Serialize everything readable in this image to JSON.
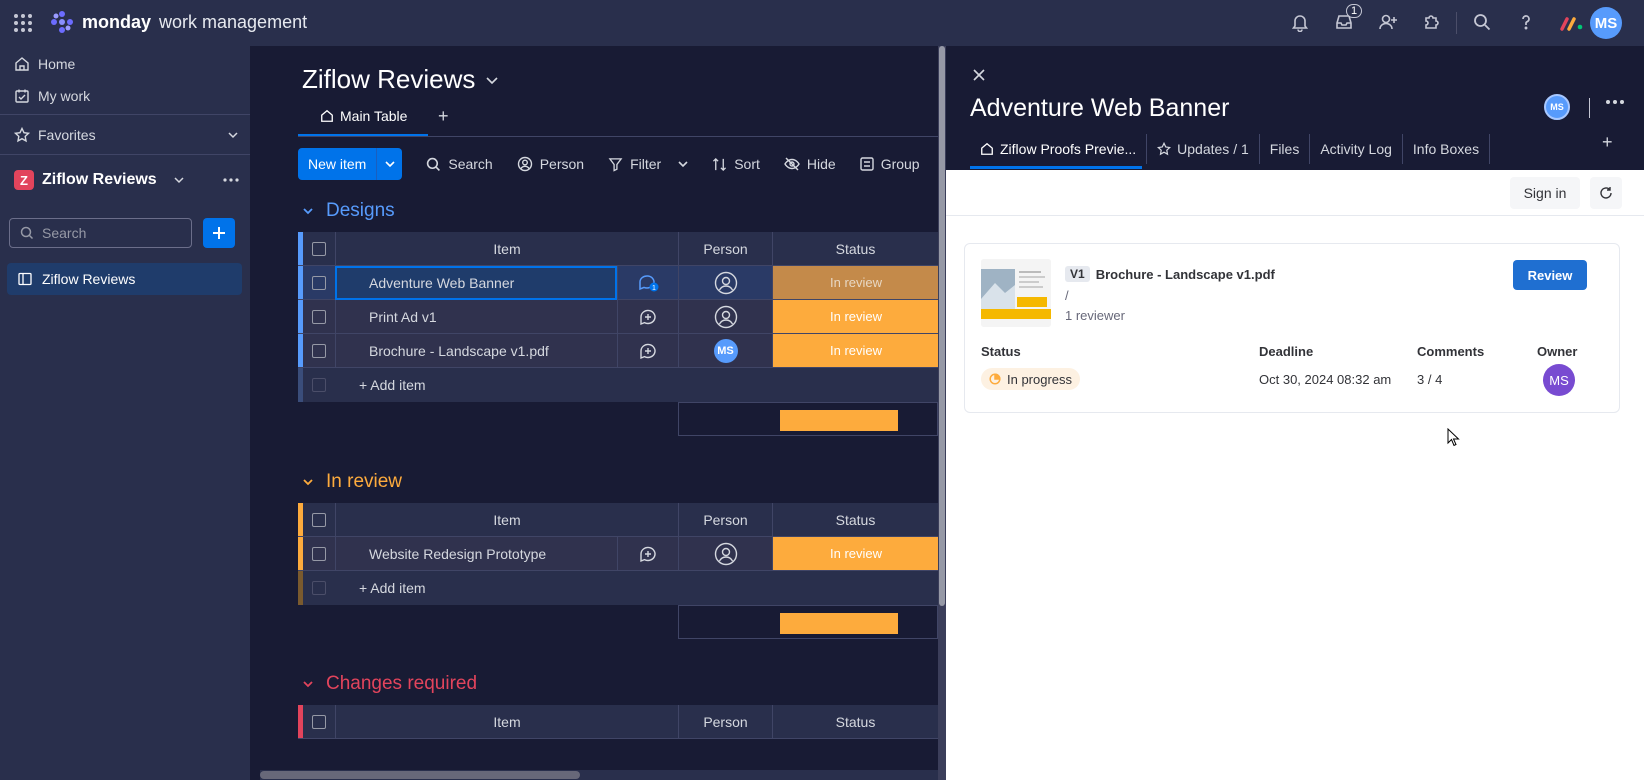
{
  "app": {
    "brand_bold": "monday",
    "brand_light": "work management",
    "inbox_count": "1",
    "user_initials": "MS"
  },
  "sidebar": {
    "home": "Home",
    "my_work": "My work",
    "favorites": "Favorites",
    "workspace_letter": "Z",
    "workspace_name": "Ziflow Reviews",
    "search_placeholder": "Search",
    "boards": [
      {
        "label": "Ziflow Reviews"
      }
    ]
  },
  "board": {
    "title": "Ziflow Reviews",
    "tab_main": "Main Table",
    "tab_add": "+",
    "toolbar": {
      "new_item": "New item",
      "search": "Search",
      "person": "Person",
      "filter": "Filter",
      "sort": "Sort",
      "hide": "Hide",
      "group": "Group"
    },
    "columns": {
      "item": "Item",
      "person": "Person",
      "status": "Status"
    },
    "add_item": "+ Add item",
    "groups": [
      {
        "title": "Designs",
        "color": "#579bfc",
        "rows": [
          {
            "item": "Adventure Web Banner",
            "status": "In review",
            "update_count": "1"
          },
          {
            "item": "Print Ad v1",
            "status": "In review"
          },
          {
            "item": "Brochure - Landscape v1.pdf",
            "status": "In review",
            "person": "MS"
          }
        ]
      },
      {
        "title": "In review",
        "color": "#fdab3d",
        "rows": [
          {
            "item": "Website Redesign Prototype",
            "status": "In review"
          }
        ]
      },
      {
        "title": "Changes required",
        "color": "#e2445c",
        "rows": []
      }
    ]
  },
  "panel": {
    "title": "Adventure Web Banner",
    "avatar": "MS",
    "tabs": [
      "Ziflow Proofs Previe...",
      "Updates / 1",
      "Files",
      "Activity Log",
      "Info Boxes"
    ],
    "add_tab": "+",
    "sign_in": "Sign in",
    "proof": {
      "version": "V1",
      "name": "Brochure - Landscape v1.pdf",
      "path": "/",
      "reviewers": "1 reviewer",
      "review_button": "Review",
      "labels": {
        "status": "Status",
        "deadline": "Deadline",
        "comments": "Comments",
        "owner": "Owner"
      },
      "status": "In progress",
      "deadline": "Oct 30, 2024 08:32 am",
      "comments": "3 / 4",
      "owner": "MS"
    }
  },
  "colors": {
    "accent": "#0073ea",
    "status_in_review": "#fdab3d",
    "group_designs": "#579bfc",
    "group_in_review": "#fdab3d",
    "group_changes": "#e2445c"
  }
}
